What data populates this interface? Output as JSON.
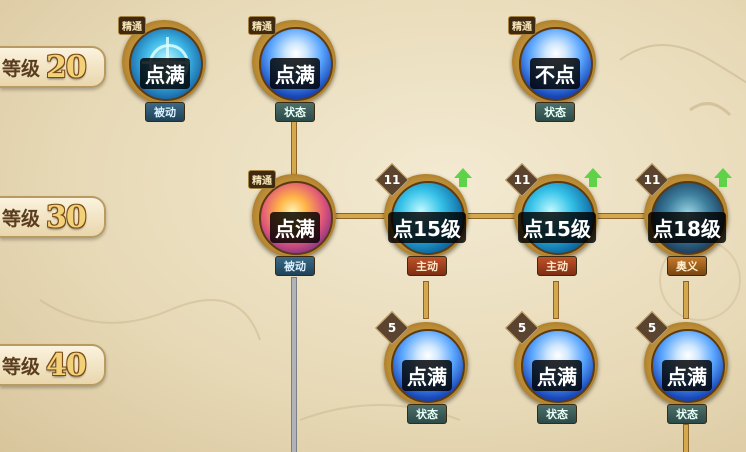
{
  "tiers": [
    {
      "word": "等级",
      "level": "20"
    },
    {
      "word": "等级",
      "level": "30"
    },
    {
      "word": "等级",
      "level": "40"
    }
  ],
  "skills": {
    "r1c1": {
      "corner": "精通",
      "advice": "点满",
      "type": "被动"
    },
    "r1c2": {
      "corner": "精通",
      "advice": "点满",
      "type": "状态"
    },
    "r1c4": {
      "corner": "精通",
      "advice": "不点",
      "type": "状态"
    },
    "r2c2": {
      "corner": "精通",
      "advice": "点满",
      "type": "被动"
    },
    "r2c3": {
      "level": "11",
      "advice": "点15级",
      "type": "主动"
    },
    "r2c4": {
      "level": "11",
      "advice": "点15级",
      "type": "主动"
    },
    "r2c5": {
      "level": "11",
      "advice": "点18级",
      "type": "奥义"
    },
    "r3c3": {
      "level": "5",
      "advice": "点满",
      "type": "状态"
    },
    "r3c4": {
      "level": "5",
      "advice": "点满",
      "type": "状态"
    },
    "r3c5": {
      "level": "5",
      "advice": "点满",
      "type": "状态"
    }
  },
  "colors": {
    "line_gold": "#d6a84e",
    "line_grey": "#b0b4b8",
    "upgrade_green": "#5fd24a"
  }
}
